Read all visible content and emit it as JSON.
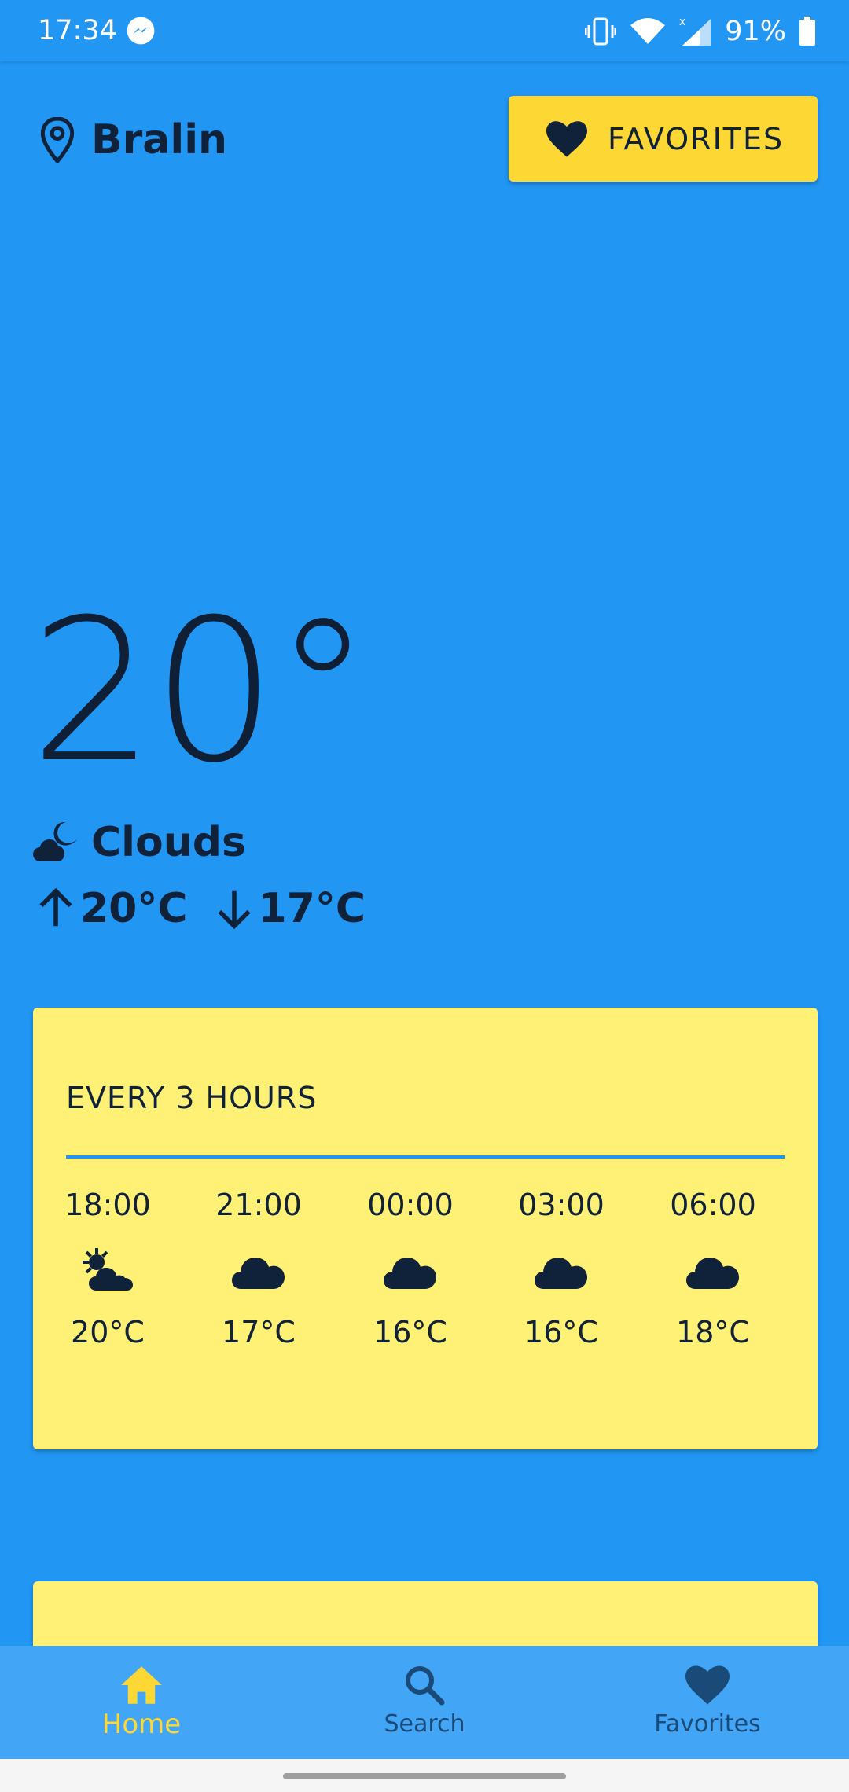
{
  "status_bar": {
    "time": "17:34",
    "battery_percent": "91%",
    "icons": [
      "messenger-icon",
      "vibrate-icon",
      "wifi-icon",
      "signal-icon",
      "battery-icon"
    ]
  },
  "location": {
    "name": "Bralin",
    "icon": "location-pin-icon"
  },
  "favorites_button": {
    "label": "FAVORITES",
    "icon": "heart-icon"
  },
  "current": {
    "temperature": "20°",
    "condition": "Clouds",
    "condition_icon": "cloud-moon-icon",
    "max": "20°C",
    "min": "17°C"
  },
  "forecast": {
    "title": "EVERY 3 HOURS",
    "items": [
      {
        "time": "18:00",
        "icon": "cloud-sun-icon",
        "temp": "20°C"
      },
      {
        "time": "21:00",
        "icon": "cloud-icon",
        "temp": "17°C"
      },
      {
        "time": "00:00",
        "icon": "cloud-icon",
        "temp": "16°C"
      },
      {
        "time": "03:00",
        "icon": "cloud-icon",
        "temp": "16°C"
      },
      {
        "time": "06:00",
        "icon": "cloud-icon",
        "temp": "18°C"
      }
    ]
  },
  "bottom_nav": {
    "items": [
      {
        "label": "Home",
        "icon": "home-icon",
        "active": true
      },
      {
        "label": "Search",
        "icon": "search-icon",
        "active": false
      },
      {
        "label": "Favorites",
        "icon": "heart-icon",
        "active": false
      }
    ]
  },
  "colors": {
    "background": "#2196F3",
    "accent": "#FDD835",
    "card": "#FFF176",
    "nav": "#42A5F5",
    "text": "#10213A"
  }
}
